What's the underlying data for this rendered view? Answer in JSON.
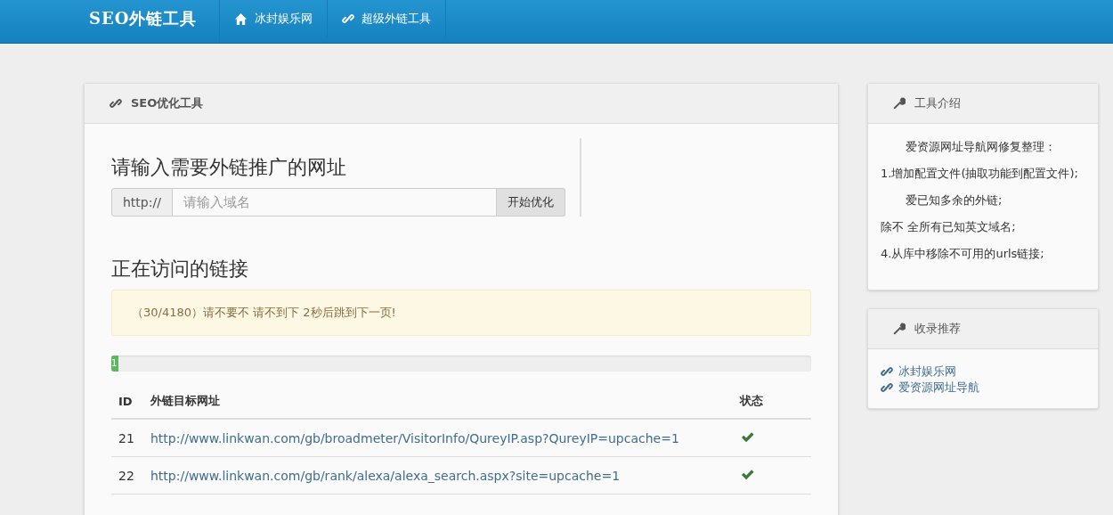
{
  "navbar": {
    "brand": "SEO外链工具",
    "links": [
      {
        "kind": "home",
        "label": "冰封娱乐网"
      },
      {
        "kind": "link",
        "label": "超级外链工具"
      }
    ]
  },
  "main_panel": {
    "title": "SEO优化工具",
    "form": {
      "heading": "请输入需要外链推广的网址",
      "prefix": "http://",
      "placeholder": "请输入域名",
      "button": "开始优化"
    },
    "progress_section": {
      "heading": "正在访问的链接",
      "alert": "（30/4180）请不要不 请不到下 2秒后跳到下一页!",
      "progress": {
        "level": 0.01,
        "label": "1"
      }
    },
    "table": {
      "columns": [
        "ID",
        "外链目标网址",
        "状态"
      ],
      "rows": [
        {
          "id": "21",
          "url": "http://www.linkwan.com/gb/broadmeter/VisitorInfo/QureyIP.asp?QureyIP=upcache=1",
          "ok": true
        },
        {
          "id": "22",
          "url": "http://www.linkwan.com/gb/rank/alexa/alexa_search.aspx?site=upcache=1",
          "ok": true
        }
      ]
    }
  },
  "intro_panel": {
    "title": "工具介绍",
    "lines": [
      "爱资源网址导航网修复整理：",
      "1.增加配置文件(抽取功能到配置文件);",
      "爱已知多余的外链;",
      "除不 全所有已知英文域名;",
      "4.从库中移除不可用的urls链接;"
    ]
  },
  "links_panel": {
    "title": "收录推荐",
    "links": [
      "冰封娱乐网",
      "爱资源网址导航"
    ]
  }
}
